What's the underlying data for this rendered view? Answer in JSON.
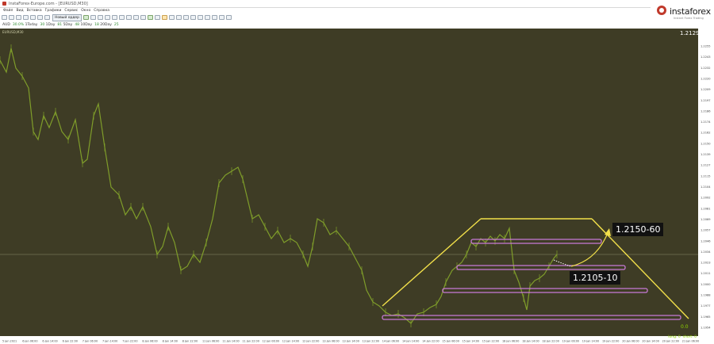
{
  "window": {
    "title": "InstaForex-Europe.com - [EURUSD,M30]"
  },
  "menu": [
    "Файл",
    "Вид",
    "Вставка",
    "Графики",
    "Сервис",
    "Окно",
    "Справка"
  ],
  "toolbar": {
    "new_order": "Новый ордер"
  },
  "timeframe_bar": {
    "symbol": "AUD",
    "items": [
      {
        "label": "30.0%",
        "value": "1Today"
      },
      {
        "label": "30",
        "value": "1Day"
      },
      {
        "label": "81",
        "value": "5Day"
      },
      {
        "label": "48",
        "value": "10Day"
      },
      {
        "label": "18",
        "value": "20Day"
      },
      {
        "label": "25",
        "value": ""
      }
    ]
  },
  "brand": {
    "name": "instaforex",
    "tagline": "Instant Forex Trading"
  },
  "chart": {
    "symbol_label": "EURUSD,M30",
    "current_price": "1.21299",
    "target_upper": "1.2150-60",
    "target_lower": "1.2105-10",
    "zero_label": "0.0",
    "stats_long": "long: 0",
    "stats_short": "short: 0",
    "colors": {
      "background": "#3e3c25",
      "candles": "#7f9d2a",
      "channel": "#f2e04a",
      "zones": "#c87ad6"
    },
    "y_ticks": [
      "1.2255",
      "1.2243",
      "1.2232",
      "1.2220",
      "1.2209",
      "1.2197",
      "1.2186",
      "1.2174",
      "1.2162",
      "1.2150",
      "1.2139",
      "1.2127",
      "1.2115",
      "1.2104",
      "1.2092",
      "1.2081",
      "1.2069",
      "1.2057",
      "1.2046",
      "1.2034",
      "1.2023",
      "1.2011",
      "1.2000",
      "1.1988",
      "1.1977",
      "1.1965",
      "1.1954"
    ],
    "x_ticks": [
      "5 Jan 2021",
      "6 Jan 06:00",
      "6 Jan 14:00",
      "6 Jan 22:00",
      "7 Jan 06:00",
      "7 Jan 14:00",
      "7 Jan 22:00",
      "8 Jan 06:00",
      "8 Jan 14:00",
      "8 Jan 22:00",
      "11 Jan 06:00",
      "11 Jan 14:00",
      "11 Jan 22:00",
      "12 Jan 06:00",
      "12 Jan 14:00",
      "12 Jan 22:00",
      "13 Jan 06:00",
      "13 Jan 14:00",
      "13 Jan 22:00",
      "14 Jan 06:00",
      "14 Jan 14:00",
      "14 Jan 22:00",
      "15 Jan 06:00",
      "15 Jan 14:00",
      "15 Jan 22:00",
      "18 Jan 06:00",
      "18 Jan 14:00",
      "18 Jan 22:00",
      "19 Jan 06:00",
      "19 Jan 14:00",
      "19 Jan 22:00",
      "20 Jan 06:00",
      "20 Jan 14:00",
      "20 Jan 22:00",
      "21 Jan 06:00"
    ]
  }
}
